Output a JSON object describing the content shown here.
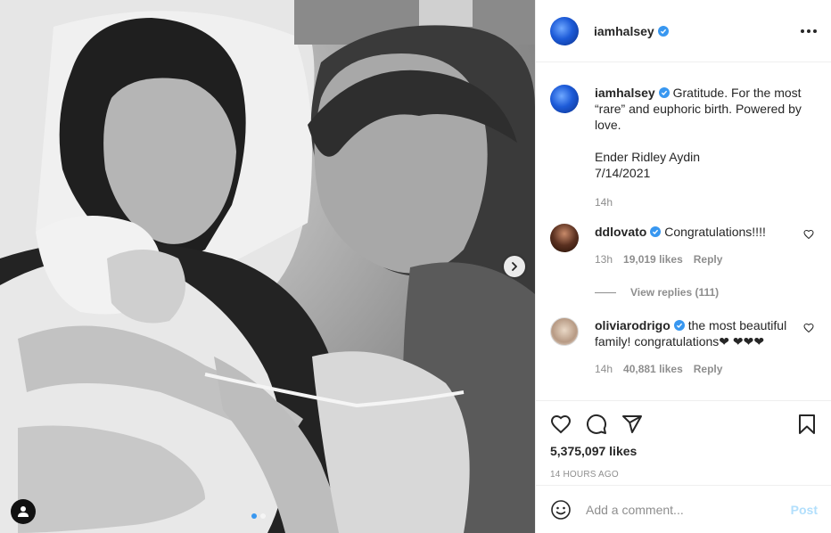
{
  "post": {
    "author": "iamhalsey",
    "verified": true,
    "caption_text": "Gratitude. For the most “rare” and euphoric birth. Powered by love.",
    "caption_line2": "Ender Ridley Aydin",
    "caption_line3": "7/14/2021",
    "caption_time": "14h",
    "likes": "5,375,097 likes",
    "time_ago": "14 HOURS AGO",
    "carousel_dots": 2,
    "carousel_active": 1
  },
  "comments": [
    {
      "username": "ddlovato",
      "verified": true,
      "text": "Congratulations!!!!",
      "time": "13h",
      "likes": "19,019 likes",
      "reply_label": "Reply",
      "view_replies": "View replies (111)"
    },
    {
      "username": "oliviarodrigo",
      "verified": true,
      "text": "the most beautiful family! congratulations❤ ❤❤❤",
      "time": "14h",
      "likes": "40,881 likes",
      "reply_label": "Reply"
    }
  ],
  "add_comment": {
    "placeholder": "Add a comment...",
    "post_label": "Post"
  },
  "icons": {
    "more": "more-options-icon",
    "like": "heart-icon",
    "comment": "comment-icon",
    "share": "share-icon",
    "save": "bookmark-icon",
    "emoji": "emoji-icon",
    "next": "chevron-right-icon",
    "tags": "user-tag-icon"
  },
  "colors": {
    "verified_blue": "#3897f0",
    "text": "#262626",
    "muted": "#8e8e8e",
    "post_button": "#b2dffc",
    "border": "#efefef"
  }
}
